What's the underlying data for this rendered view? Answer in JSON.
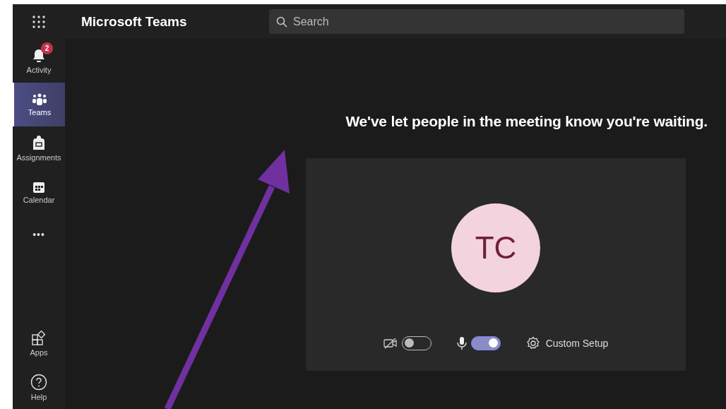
{
  "app": {
    "title": "Microsoft Teams"
  },
  "search": {
    "placeholder": "Search"
  },
  "rail": [
    {
      "kind": "activity",
      "label": "Activity",
      "badge": "2",
      "selected": false
    },
    {
      "kind": "teams",
      "label": "Teams",
      "selected": true
    },
    {
      "kind": "assignments",
      "label": "Assignments",
      "selected": false
    },
    {
      "kind": "calendar",
      "label": "Calendar",
      "selected": false
    },
    {
      "kind": "more",
      "label": "•••",
      "selected": false
    }
  ],
  "rail_bottom": [
    {
      "kind": "apps",
      "label": "Apps"
    },
    {
      "kind": "help",
      "label": "Help"
    }
  ],
  "message": "We've let people in the meeting know you're waiting.",
  "preview": {
    "initials": "TC",
    "camera_on": false,
    "mic_on": true,
    "setup": "Custom Setup"
  }
}
